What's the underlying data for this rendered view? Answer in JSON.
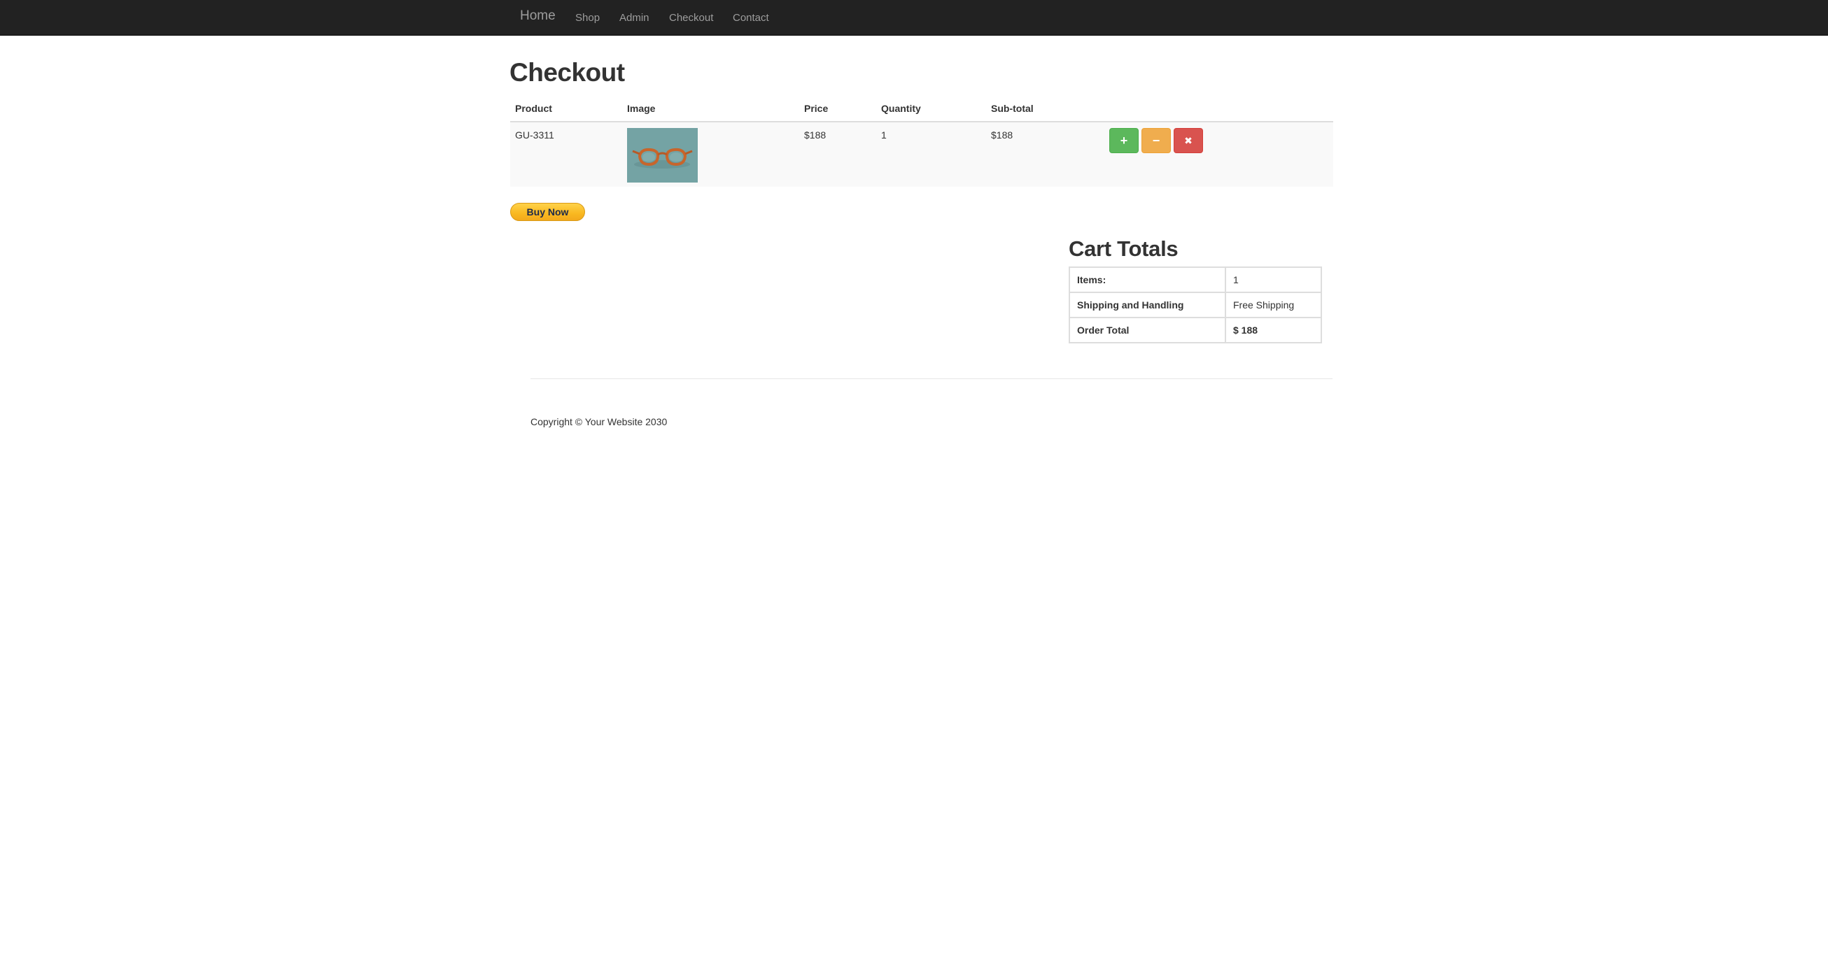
{
  "nav": {
    "brand": "Home",
    "links": [
      "Shop",
      "Admin",
      "Checkout",
      "Contact"
    ]
  },
  "page": {
    "title": "Checkout"
  },
  "cart_table": {
    "headers": [
      "Product",
      "Image",
      "Price",
      "Quantity",
      "Sub-total"
    ],
    "rows": [
      {
        "product": "GU-3311",
        "image_icon": "eyeglasses-image",
        "price": "$188",
        "quantity": "1",
        "subtotal": "$188",
        "actions": {
          "add_icon": "+",
          "remove_icon": "−",
          "delete_icon": "✖"
        }
      }
    ]
  },
  "buy_now": {
    "label": "Buy Now"
  },
  "cart_totals": {
    "title": "Cart Totals",
    "rows": [
      {
        "label": "Items:",
        "value": "1"
      },
      {
        "label": "Shipping and Handling",
        "value": "Free Shipping"
      },
      {
        "label": "Order Total",
        "value": "$ 188"
      }
    ]
  },
  "footer": {
    "copyright": "Copyright © Your Website 2030"
  },
  "colors": {
    "navbar": "#222222",
    "add_button": "#5cb85c",
    "subtract_button": "#f0ad4e",
    "delete_button": "#d9534f",
    "paypal_button": "#f9b820"
  }
}
